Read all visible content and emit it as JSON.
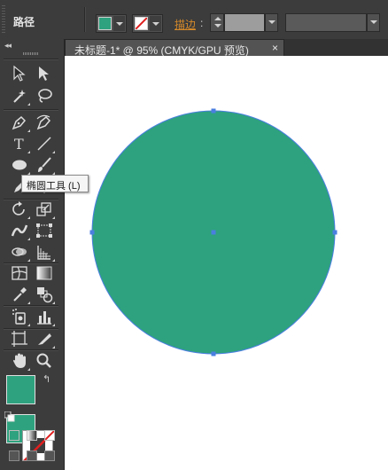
{
  "control_bar": {
    "title": "路径",
    "stroke_label": "描边",
    "stroke_colon": ":",
    "fill_swatch_color": "#2ea27e",
    "stroke_swatch": "none-slash"
  },
  "document": {
    "tab_label": "未标题-1* @ 95% (CMYK/GPU 预览)",
    "close_glyph": "×",
    "shape": "ellipse",
    "shape_fill": "#2ea27e",
    "selection_color": "#4a7fe0"
  },
  "tools_panel": {
    "collapse_glyph": "◂◂",
    "tooltip": "椭圆工具 (L)",
    "tools": [
      "selection-icon",
      "direct-selection-icon",
      "magic-wand-icon",
      "lasso-icon",
      "pen-icon",
      "curvature-icon",
      "type-icon",
      "line-segment-icon",
      "ellipse-icon",
      "paintbrush-icon",
      "pencil-icon",
      "eraser-icon",
      "rotate-icon",
      "scale-icon",
      "width-icon",
      "free-transform-icon",
      "shape-builder-icon",
      "perspective-grid-icon",
      "mesh-icon",
      "gradient-icon",
      "eyedropper-icon",
      "blend-icon",
      "symbol-sprayer-icon",
      "column-graph-icon",
      "artboard-icon",
      "slice-icon",
      "hand-icon",
      "zoom-icon"
    ],
    "fill_color": "#2ea27e",
    "stroke_color": "none",
    "swap_glyph": "↰"
  }
}
